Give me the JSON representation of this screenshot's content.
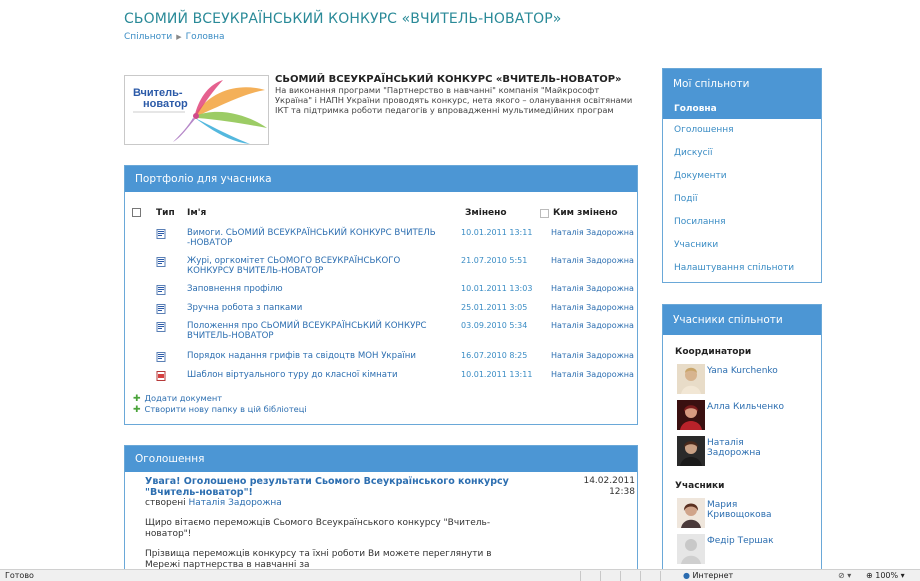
{
  "header": {
    "title": "СЬОМИЙ ВСЕУКРАЇНСЬКИЙ КОНКУРС «ВЧИТЕЛЬ-НОВАТОР»",
    "breadcrumb": [
      "Спільноти",
      "Головна"
    ]
  },
  "intro": {
    "logo_text_1": "Вчитель-",
    "logo_text_2": "новатор",
    "title": "СЬОМИЙ ВСЕУКРАЇНСЬКИЙ КОНКУРС «ВЧИТЕЛЬ-НОВАТОР»",
    "description": "На виконання програми \"Партнерство в навчанні\" компанія \"Майкрософт Україна\" і НАПН України проводять конкурс, нета якого – оланування освітянами ІКТ та підтримка роботи педагогів у впровадженні мультимедійних програм"
  },
  "portfolio": {
    "title": "Портфоліо для учасника",
    "columns": {
      "type": "Тип",
      "name": "Ім'я",
      "modified": "Змінено",
      "modified_by": "Ким змінено"
    },
    "rows": [
      {
        "icon": "word-doc-icon",
        "name": "Вимоги. СЬОМИЙ ВСЕУКРАЇНСЬКИЙ КОНКУРС ВЧИТЕЛЬ -НОВАТОР",
        "modified": "10.01.2011 13:11",
        "by": "Наталія Задорожна"
      },
      {
        "icon": "word-doc-icon",
        "name": "Журі, оргкомітет СЬОМОГО ВСЕУКРАЇНСЬКОГО КОНКУРСУ ВЧИТЕЛЬ-НОВАТОР",
        "modified": "21.07.2010 5:51",
        "by": "Наталія Задорожна"
      },
      {
        "icon": "word-doc-icon",
        "name": "Заповнення профілю",
        "modified": "10.01.2011 13:03",
        "by": "Наталія Задорожна"
      },
      {
        "icon": "word-doc-icon",
        "name": "Зручна робота з папками",
        "modified": "25.01.2011 3:05",
        "by": "Наталія Задорожна"
      },
      {
        "icon": "word-doc-icon",
        "name": "Положення про СЬОМИЙ ВСЕУКРАЇНСЬКИЙ КОНКУРС ВЧИТЕЛЬ-НОВАТОР",
        "modified": "03.09.2010 5:34",
        "by": "Наталія Задорожна"
      },
      {
        "icon": "word-doc-icon",
        "name": "Порядок надання грифів та свідоцтв МОН України",
        "modified": "16.07.2010 8:25",
        "by": "Наталія Задорожна"
      },
      {
        "icon": "pdf-doc-icon",
        "name": "Шаблон віртуального туру до класної кімнати",
        "modified": "10.01.2011 13:11",
        "by": "Наталія Задорожна"
      }
    ],
    "add_document": "Додати документ",
    "create_folder": "Створити нову папку в цій бібліотеці"
  },
  "announcements": {
    "title": "Оголошення",
    "item": {
      "headline": "Увага! Оголошено результати Сьомого Всеукраїнського конкурсу \"Вчитель-новатор\"!",
      "date": "14.02.2011",
      "time": "12:38",
      "created_label": "створені",
      "author": "Наталія Задорожна",
      "para1": "Щиро вітаємо переможців Сьомого Всеукраїнського конкурсу \"Вчитель-новатор\"!",
      "para2": "Прізвища переможців конкурсу та їхні роботи Ви можете переглянути в Мережі партнерства в навчанні за"
    }
  },
  "my_communities": {
    "title": "Мої спільноти",
    "items": [
      "Головна",
      "Оголошення",
      "Дискусії",
      "Документи",
      "Події",
      "Посилання",
      "Учасники",
      "Налаштування спільноти"
    ]
  },
  "members": {
    "title": "Учасники спільноти",
    "coordinators_label": "Координатори",
    "coordinators": [
      "Yana Kurchenko",
      "Алла Кильченко",
      "Наталія Задорожна"
    ],
    "participants_label": "Учасники",
    "participants": [
      "Мария Кривощокова",
      "Федір Тершак"
    ]
  },
  "status": {
    "left": "Готово",
    "zone": "Интернет",
    "zoom": "100%"
  },
  "colors": {
    "accent": "#4c96d4",
    "link": "#2c6eb0",
    "title": "#2a8a98"
  }
}
